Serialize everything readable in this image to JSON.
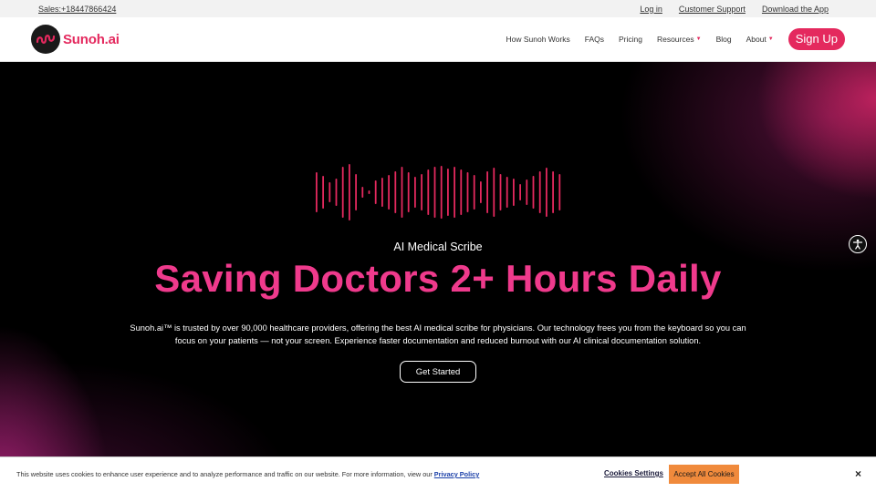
{
  "topbar": {
    "sales": "Sales:+18447866424",
    "links": [
      "Log in",
      "Customer Support",
      "Download the App"
    ]
  },
  "nav": {
    "logo_text": "Sunoh.ai",
    "items": [
      "How Sunoh Works",
      "FAQs",
      "Pricing",
      "Resources",
      "Blog",
      "About"
    ],
    "signup": "Sign Up"
  },
  "hero": {
    "eyebrow": "AI Medical Scribe",
    "headline": "Saving Doctors 2+ Hours Daily",
    "description": "Sunoh.ai™ is trusted by over 90,000 healthcare providers, offering the best AI medical scribe for physicians. Our technology frees you from the keyboard so you can focus on your patients — not your screen. Experience faster documentation and reduced burnout with our AI clinical documentation solution.",
    "cta": "Get Started"
  },
  "cookie": {
    "text": "This website uses cookies to enhance user experience and to analyze performance and traffic on our website. For more information, view our",
    "link": "Privacy Policy",
    "settings": "Cookies Settings",
    "accept": "Accept All Cookies",
    "close": "×"
  },
  "colors": {
    "brand": "#e4295e",
    "headline": "#ef3a8c",
    "accept": "#f08a3c"
  }
}
